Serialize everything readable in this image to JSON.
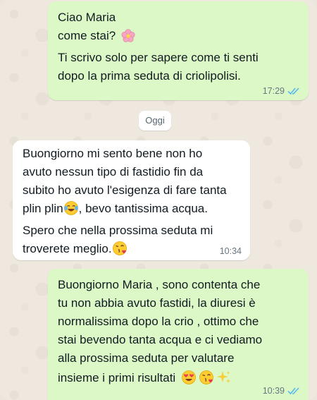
{
  "chat": {
    "messages": [
      {
        "direction": "outgoing",
        "lines": [
          "Ciao Maria",
          "come stai?",
          "Ti scrivo solo per sapere come ti senti",
          "dopo la prima seduta di criolipolisi."
        ],
        "time": "17:29",
        "status": "read"
      },
      {
        "direction": "incoming",
        "lines": [
          "Buongiorno mi sento bene non ho",
          "avuto nessun tipo di fastidio fin da",
          "subito ho avuto l'esigenza di fare tanta",
          "plin plin",
          ", bevo tantissima acqua.",
          "Spero che nella prossima seduta mi",
          "troverete meglio."
        ],
        "time": "10:34"
      },
      {
        "direction": "outgoing",
        "lines": [
          "Buongiorno Maria , sono contenta che",
          "tu non abbia avuto fastidi, la diuresi è",
          "normalissima dopo la crio , ottimo che",
          "stai bevendo tanta acqua e ci vediamo",
          "alla prossima seduta per valutare",
          "insieme i primi risultati"
        ],
        "time": "10:39",
        "status": "read"
      }
    ],
    "day_separator": "Oggi",
    "colors": {
      "outgoing_bubble": "#dcf8c6",
      "incoming_bubble": "#ffffff",
      "read_ticks": "#53bdeb"
    },
    "icons": [
      "cherry-blossom-emoji",
      "laughing-tears-emoji",
      "kiss-emoji",
      "heart-eyes-emoji",
      "sparkles-emoji",
      "double-check-icon"
    ]
  }
}
